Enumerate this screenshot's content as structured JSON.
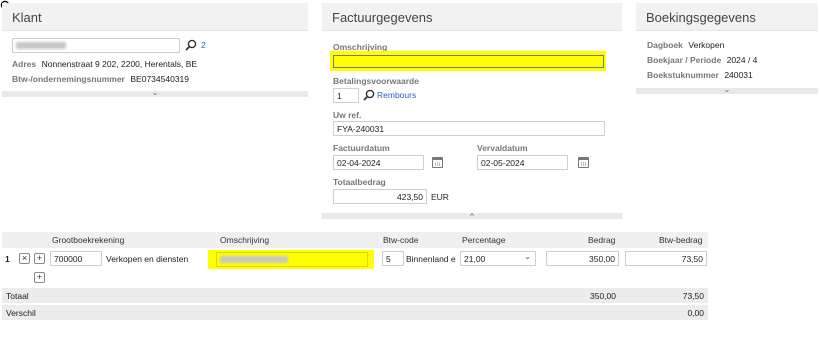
{
  "klant": {
    "title": "Klant",
    "count": "2",
    "adres_label": "Adres",
    "adres_value": "Nonnenstraat 9 202, 2200, Herentals, BE",
    "btw_label": "Btw-/ondernemingsnummer",
    "btw_value": "BE0734540319"
  },
  "factuur": {
    "title": "Factuurgegevens",
    "omschrijving_label": "Omschrijving",
    "omschrijving_value": "",
    "betaling_label": "Betalingsvoorwaarde",
    "betaling_value": "1",
    "betaling_link": "Rembours",
    "uwref_label": "Uw ref.",
    "uwref_value": "FYA-240031",
    "factuurdatum_label": "Factuurdatum",
    "factuurdatum_value": "02-04-2024",
    "vervaldatum_label": "Vervaldatum",
    "vervaldatum_value": "02-05-2024",
    "totaal_label": "Totaalbedrag",
    "totaal_value": "423,50",
    "currency": "EUR"
  },
  "boeking": {
    "title": "Boekingsgegevens",
    "dagboek_label": "Dagboek",
    "dagboek_value": "Verkopen",
    "periode_label": "Boekjaar / Periode",
    "periode_value": "2024 / 4",
    "stuk_label": "Boekstuknummer",
    "stuk_value": "240031"
  },
  "table": {
    "headers": {
      "grootboek": "Grootboekrekening",
      "omschrijving": "Omschrijving",
      "btwcode": "Btw-code",
      "percentage": "Percentage",
      "bedrag": "Bedrag",
      "btwbedrag": "Btw-bedrag"
    },
    "rows": [
      {
        "nr": "1",
        "account": "700000",
        "account_name": "Verkopen en diensten",
        "btwcode": "5",
        "btwcode_name": "Binnenland e",
        "percentage": "21,00",
        "bedrag": "350,00",
        "btwbedrag": "73,50"
      }
    ],
    "totaal_label": "Totaal",
    "totaal_bedrag": "350,00",
    "totaal_btw": "73,50",
    "verschil_label": "Verschil",
    "verschil_btw": "0,00"
  },
  "icons": {
    "close": "×",
    "plus": "+",
    "chevron_down": "⌄",
    "chevron_up": "^"
  },
  "colors": {
    "highlight": "#ffff00",
    "link": "#2a62b8"
  }
}
